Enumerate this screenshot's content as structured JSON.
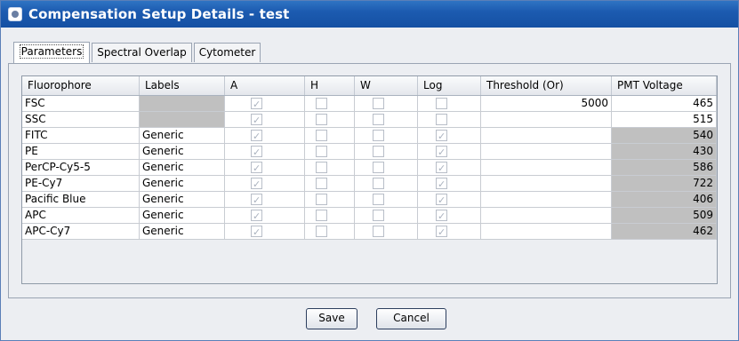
{
  "window": {
    "title": "Compensation Setup Details - test"
  },
  "tabs": [
    {
      "label": "Parameters"
    },
    {
      "label": "Spectral Overlap"
    },
    {
      "label": "Cytometer"
    }
  ],
  "table": {
    "columns": [
      "Fluorophore",
      "Labels",
      "A",
      "H",
      "W",
      "Log",
      "Threshold (Or)",
      "PMT Voltage"
    ],
    "rows": [
      {
        "fluorophore": "FSC",
        "labels": "",
        "threshold": "5000",
        "pmt": "465"
      },
      {
        "fluorophore": "SSC",
        "labels": "",
        "threshold": "",
        "pmt": "515"
      },
      {
        "fluorophore": "FITC",
        "labels": "Generic",
        "threshold": "",
        "pmt": "540"
      },
      {
        "fluorophore": "PE",
        "labels": "Generic",
        "threshold": "",
        "pmt": "430"
      },
      {
        "fluorophore": "PerCP-Cy5-5",
        "labels": "Generic",
        "threshold": "",
        "pmt": "586"
      },
      {
        "fluorophore": "PE-Cy7",
        "labels": "Generic",
        "threshold": "",
        "pmt": "722"
      },
      {
        "fluorophore": "Pacific Blue",
        "labels": "Generic",
        "threshold": "",
        "pmt": "406"
      },
      {
        "fluorophore": "APC",
        "labels": "Generic",
        "threshold": "",
        "pmt": "509"
      },
      {
        "fluorophore": "APC-Cy7",
        "labels": "Generic",
        "threshold": "",
        "pmt": "462"
      }
    ],
    "checks": {
      "A": [
        true,
        true,
        true,
        true,
        true,
        true,
        true,
        true,
        true
      ],
      "H": [
        false,
        false,
        false,
        false,
        false,
        false,
        false,
        false,
        false
      ],
      "W": [
        false,
        false,
        false,
        false,
        false,
        false,
        false,
        false,
        false
      ],
      "Log": [
        false,
        false,
        true,
        true,
        true,
        true,
        true,
        true,
        true
      ]
    }
  },
  "buttons": {
    "save": "Save",
    "cancel": "Cancel"
  },
  "colors": {
    "title_bar": "#1c5bb0",
    "gray_cell": "#c0c0c0"
  }
}
